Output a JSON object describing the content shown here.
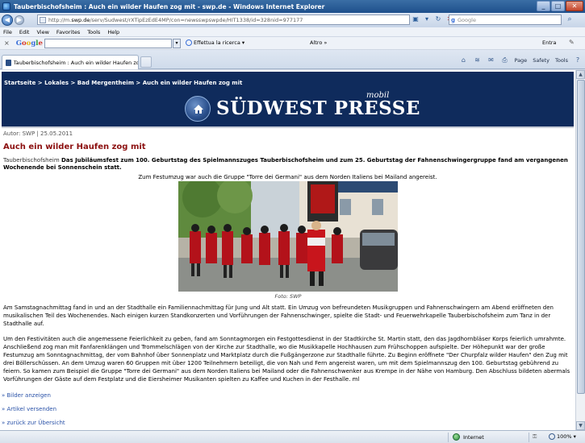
{
  "window": {
    "title": "Tauberbischofsheim : Auch ein wilder Haufen zog mit - swp.de - Windows Internet Explorer",
    "buttons": {
      "minimize": "_",
      "maximize": "□",
      "close": "✕"
    }
  },
  "address_bar": {
    "url_prefix": "http://m.",
    "url_domain": "swp.de",
    "url_rest": "/serv/Sudwest/rXTipEzEdE4MP/con=newsswpswpde/HIT1338/id=328nid=977177",
    "search_placeholder": "Google"
  },
  "menu": [
    "File",
    "Edit",
    "View",
    "Favorites",
    "Tools",
    "Help"
  ],
  "google_toolbar": {
    "close": "×",
    "logo": [
      "G",
      "o",
      "o",
      "g",
      "l",
      "e"
    ],
    "search_label": "Effettua la ricerca",
    "more_label": "Altro »",
    "signin_label": "Entra"
  },
  "tab": {
    "label": "Tauberbischofsheim : Auch ein wilder Haufen zog mit -..."
  },
  "command_bar": {
    "page": "Page",
    "safety": "Safety",
    "tools": "Tools"
  },
  "page": {
    "breadcrumb": [
      "Startseite",
      "Lokales",
      "Bad Mergentheim",
      "Auch ein wilder Haufen zog mit"
    ],
    "breadcrumb_sep": " > ",
    "logo_text": "SÜDWEST PRESSE",
    "logo_sub": "mobil",
    "meta": "Autor: SWP | 25.05.2011",
    "headline": "Auch ein wilder Haufen zog mit",
    "teaser_place": "Tauberbischofsheim",
    "teaser": "Das Jubiläumsfest zum 100. Geburtstag des Spielmannszuges Tauberbischofsheim und zum 25. Geburtstag der Fahnenschwingergruppe fand am vergangenen Wochenende bei Sonnenschein statt.",
    "caption": "Zum Festumzug war auch die Gruppe \"Torre dei Germani\" aus dem Norden Italiens bei Mailand angereist.",
    "photo_credit": "Foto: SWP",
    "paragraph1": "Am Samstagnachmittag fand in und an der Stadthalle ein Familiennachmittag für Jung und Alt statt. Ein Umzug von befreundeten Musikgruppen und Fahnenschwingern am Abend eröffneten den musikalischen Teil des Wochenendes. Nach einigen kurzen Standkonzerten und Vorführungen der Fahnenschwinger, spielte die Stadt- und Feuerwehrkapelle Tauberbischofsheim zum Tanz in der Stadthalle auf.",
    "paragraph2": "Um den Festivitäten auch die angemessene Feierlichkeit zu geben, fand am Sonntagmorgen ein Festgottesdienst in der Stadtkirche St. Martin statt, den das Jagdhornbläser Korps feierlich umrahmte. Anschließend zog man mit Fanfarenklängen und Trommelschlägen von der Kirche zur Stadthalle, wo die Musikkapelle Hochhausen zum Frühschoppen aufspielte. Der Höhepunkt war der große Festumzug am Sonntagnachmittag, der vom Bahnhof über Sonnenplatz und Marktplatz durch die Fußgängerzone zur Stadthalle führte. Zu Beginn eröffnete \"Der Churpfalz wilder Haufen\" den Zug mit drei Böllerschüssen. An dem Umzug waren 60 Gruppen mit über 1200 Teilnehmern beteiligt, die von Nah und Fern angereist waren, um mit dem Spielmannszug den 100. Geburtstag gebührend zu feiern. So kamen zum Beispiel die Gruppe \"Torre dei Germani\" aus dem Norden Italiens bei Mailand oder die Fahnenschwenker aus Krempe in der Nähe von Hamburg. Den Abschluss bildeten abermals Vorführungen der Gäste auf dem Festplatz und die Eiersheimer Musikanten spielten zu Kaffee und Kuchen in der Festhalle. ml",
    "links": [
      "» Bilder anzeigen",
      "» Artikel versenden",
      "» zurück zur Übersicht"
    ]
  },
  "status_bar": {
    "zone": "Internet",
    "zoom": "100%"
  },
  "colors": {
    "masthead": "#0f2b5c",
    "headline": "#8c1010",
    "link": "#2a52a8"
  }
}
